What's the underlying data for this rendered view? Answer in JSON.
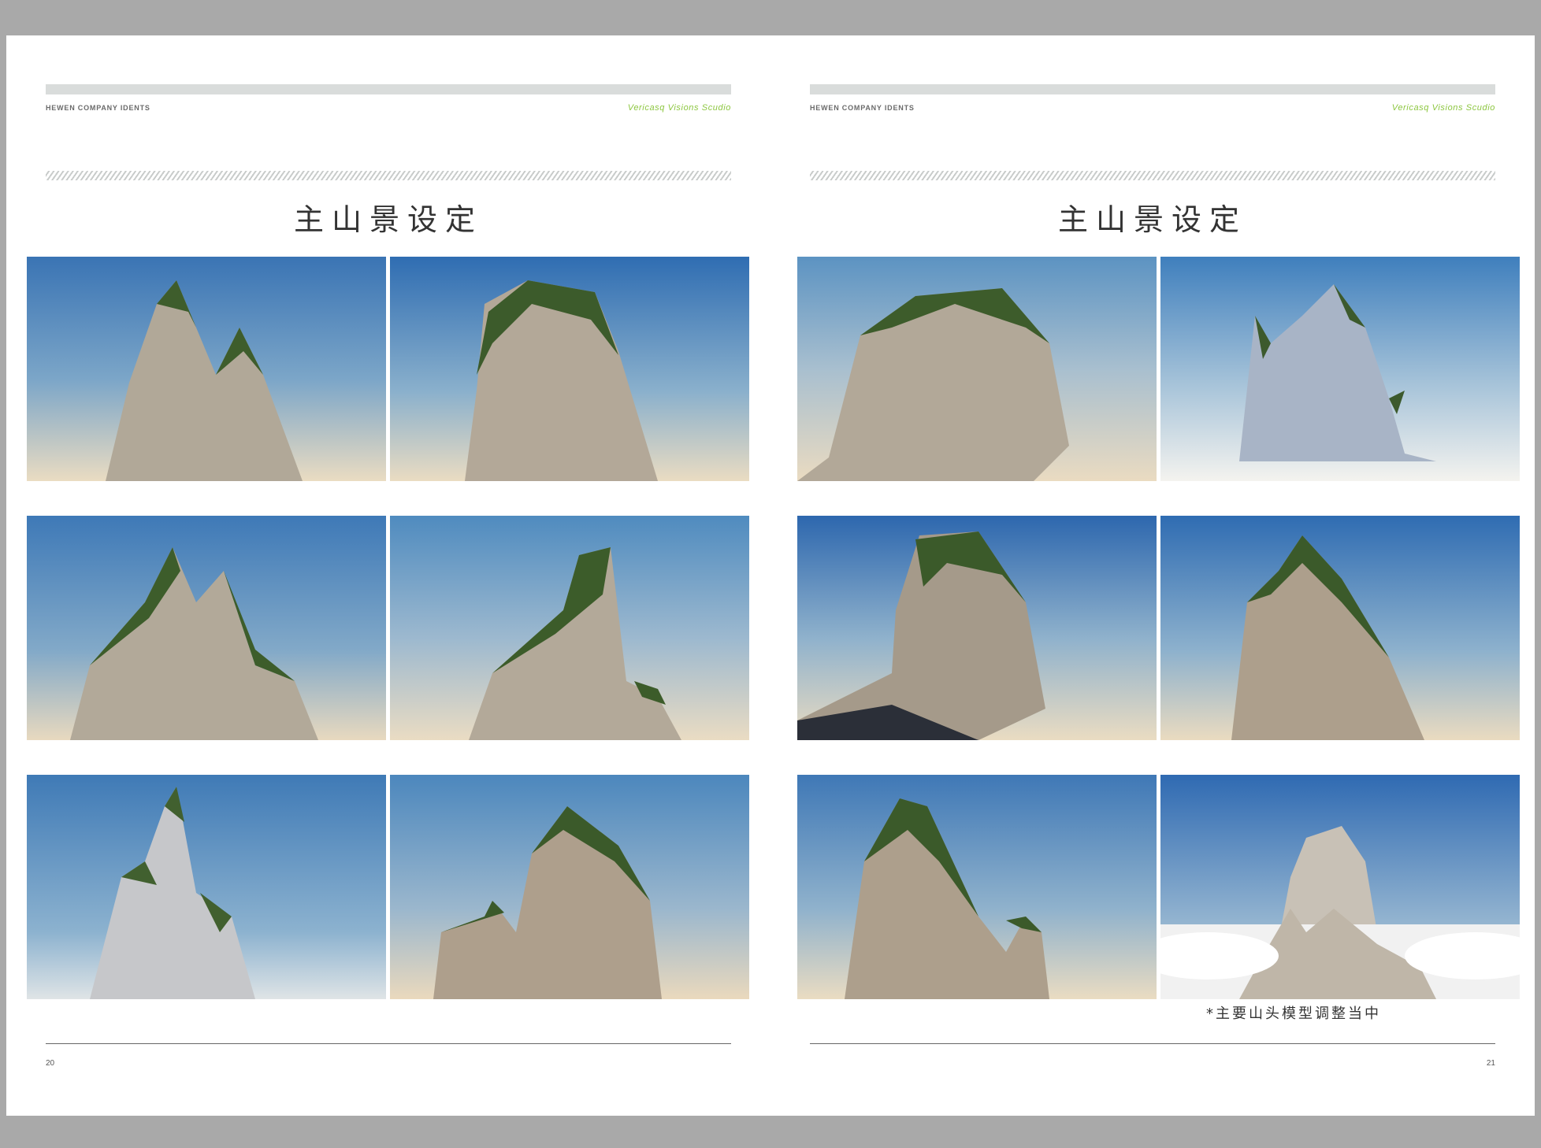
{
  "pages": [
    {
      "header_left": "HEWEN COMPANY IDENTS",
      "header_right": "Vericasq Visions Scudio",
      "title": "主山景设定",
      "page_number": "20"
    },
    {
      "header_left": "HEWEN COMPANY IDENTS",
      "header_right": "Vericasq Visions Scudio",
      "title": "主山景设定",
      "page_number": "21",
      "caption": "*主要山头模型调整当中"
    }
  ],
  "colors": {
    "accent_green": "#8cc63f",
    "sky_top": "#3a78b8",
    "sky_horizon": "#e9dcc3",
    "rock": "#b3aa9c",
    "vegetation": "#3c5e2c"
  }
}
